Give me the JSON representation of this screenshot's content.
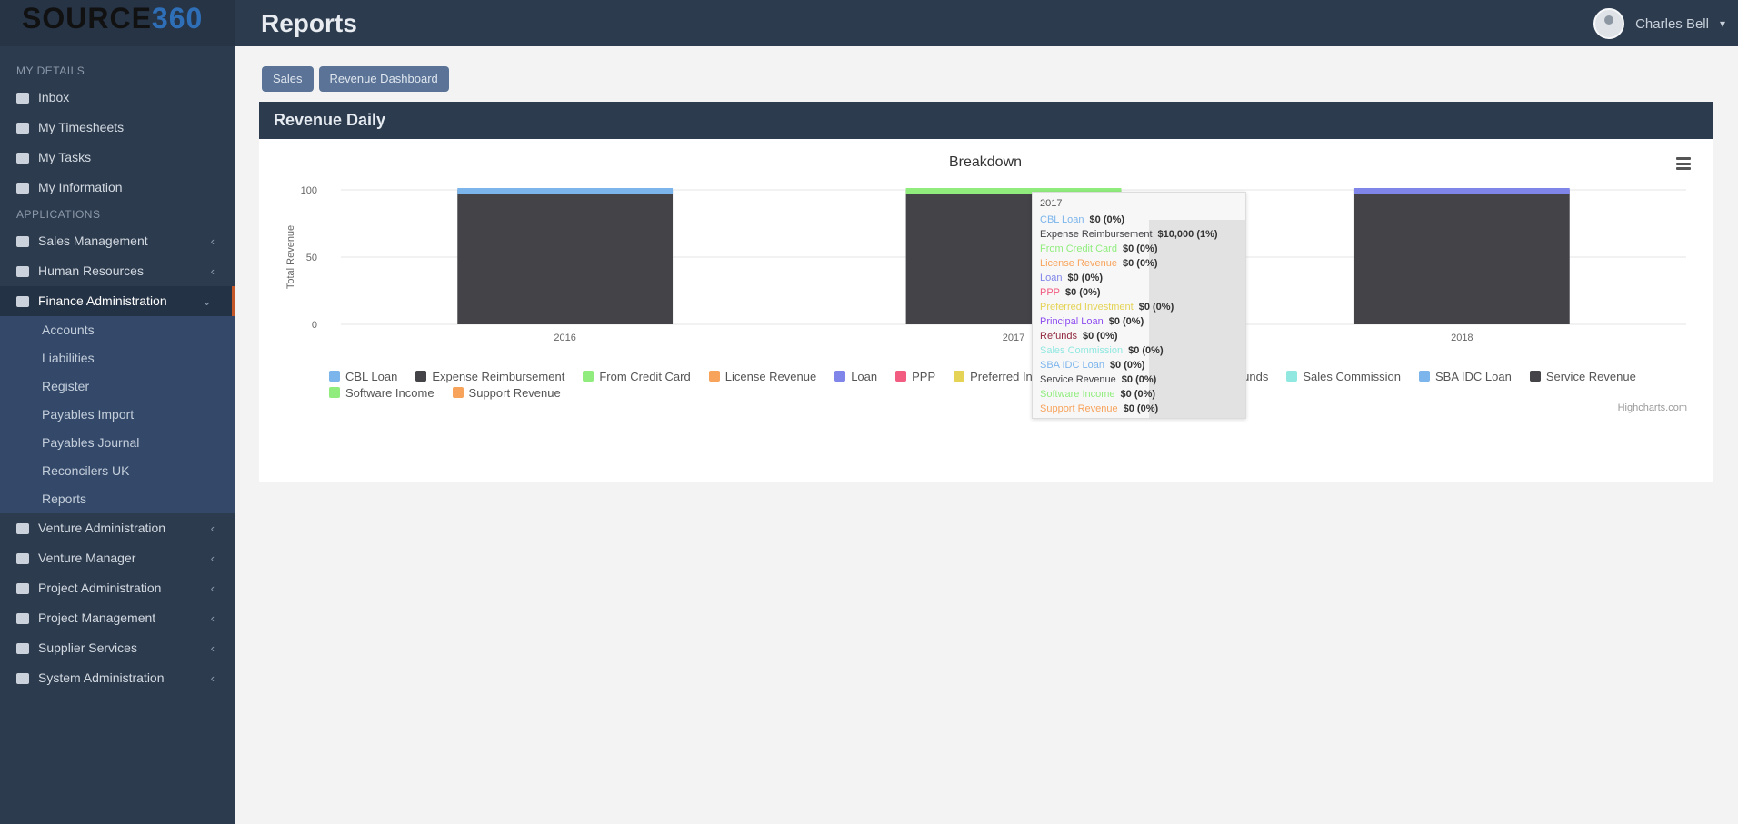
{
  "app": {
    "logo_text": "SOURCE",
    "logo_accent": "360",
    "page_title": "Reports"
  },
  "user": {
    "name": "Charles Bell"
  },
  "sidebar": {
    "section_my": "MY DETAILS",
    "my_items": [
      {
        "label": "Inbox",
        "icon": "inbox-icon"
      },
      {
        "label": "My Timesheets",
        "icon": "clock-icon"
      },
      {
        "label": "My Tasks",
        "icon": "tasks-icon"
      },
      {
        "label": "My Information",
        "icon": "user-icon"
      }
    ],
    "section_apps": "APPLICATIONS",
    "app_items": [
      {
        "label": "Sales Management",
        "icon": "chart-icon"
      },
      {
        "label": "Human Resources",
        "icon": "people-icon"
      },
      {
        "label": "Finance Administration",
        "icon": "check-icon",
        "active": true
      }
    ],
    "finance_sub": [
      "Accounts",
      "Liabilities",
      "Register",
      "Payables Import",
      "Payables Journal",
      "Reconcilers UK",
      "Reports"
    ],
    "more_items": [
      {
        "label": "Venture Administration",
        "icon": "briefcase-icon"
      },
      {
        "label": "Venture Manager",
        "icon": "folder-icon"
      },
      {
        "label": "Project Administration",
        "icon": "gear-icon"
      },
      {
        "label": "Project Management",
        "icon": "clipboard-icon"
      },
      {
        "label": "Supplier Services",
        "icon": "truck-icon"
      },
      {
        "label": "System Administration",
        "icon": "settings-icon"
      }
    ]
  },
  "breadcrumbs": [
    "Sales",
    "Revenue Dashboard"
  ],
  "panel": {
    "title": "Revenue Daily"
  },
  "chart_data": {
    "type": "bar",
    "title": "Breakdown",
    "ylabel": "Total Revenue",
    "ylim": [
      0,
      100
    ],
    "yticks": [
      "100",
      "50",
      "0"
    ],
    "categories": [
      "2016",
      "2017",
      "2018"
    ],
    "bars": [
      {
        "category": "2016",
        "value": 100,
        "top_color": "#7cb5ec"
      },
      {
        "category": "2017",
        "value": 100,
        "top_color": "#90ed7d"
      },
      {
        "category": "2018",
        "value": 100,
        "top_color": "#8085e9"
      }
    ],
    "bar_color": "#434348",
    "legend": [
      {
        "name": "CBL Loan",
        "color": "#7cb5ec"
      },
      {
        "name": "Expense Reimbursement",
        "color": "#434348"
      },
      {
        "name": "From Credit Card",
        "color": "#90ed7d"
      },
      {
        "name": "License Revenue",
        "color": "#f7a35c"
      },
      {
        "name": "Loan",
        "color": "#8085e9"
      },
      {
        "name": "PPP",
        "color": "#f15c80"
      },
      {
        "name": "Preferred Investment",
        "color": "#e4d354"
      },
      {
        "name": "Principal Loan",
        "color": "#8d4cf0"
      },
      {
        "name": "Refunds",
        "color": "#91263d"
      },
      {
        "name": "Sales Commission",
        "color": "#91e8e1"
      },
      {
        "name": "SBA IDC Loan",
        "color": "#7cb5ec"
      },
      {
        "name": "Service Revenue",
        "color": "#434348"
      },
      {
        "name": "Software Income",
        "color": "#90ed7d"
      },
      {
        "name": "Support Revenue",
        "color": "#f7a35c"
      }
    ],
    "credit": "Highcharts.com"
  },
  "tooltip": {
    "header": "2017",
    "rows": [
      {
        "name": "CBL Loan",
        "value": "$0 (0%)",
        "color": "#7cb5ec"
      },
      {
        "name": "Expense Reimbursement",
        "value": "$10,000 (1%)",
        "color": "#434348"
      },
      {
        "name": "From Credit Card",
        "value": "$0 (0%)",
        "color": "#90ed7d"
      },
      {
        "name": "License Revenue",
        "value": "$0 (0%)",
        "color": "#f7a35c"
      },
      {
        "name": "Loan",
        "value": "$0 (0%)",
        "color": "#8085e9"
      },
      {
        "name": "PPP",
        "value": "$0 (0%)",
        "color": "#f15c80"
      },
      {
        "name": "Preferred Investment",
        "value": "$0 (0%)",
        "color": "#e4d354"
      },
      {
        "name": "Principal Loan",
        "value": "$0 (0%)",
        "color": "#8d4cf0"
      },
      {
        "name": "Refunds",
        "value": "$0 (0%)",
        "color": "#91263d"
      },
      {
        "name": "Sales Commission",
        "value": "$0 (0%)",
        "color": "#91e8e1"
      },
      {
        "name": "SBA IDC Loan",
        "value": "$0 (0%)",
        "color": "#7cb5ec"
      },
      {
        "name": "Service Revenue",
        "value": "$0 (0%)",
        "color": "#434348"
      },
      {
        "name": "Software Income",
        "value": "$0 (0%)",
        "color": "#90ed7d"
      },
      {
        "name": "Support Revenue",
        "value": "$0 (0%)",
        "color": "#f7a35c"
      }
    ]
  }
}
